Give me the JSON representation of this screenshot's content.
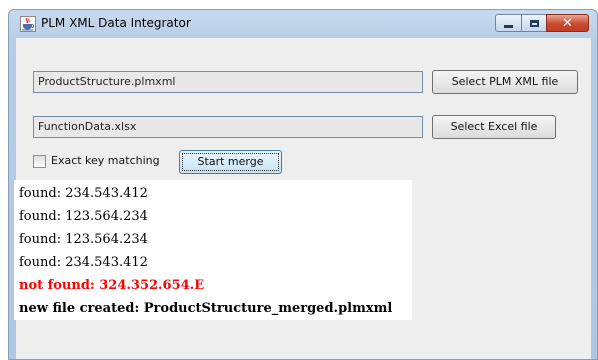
{
  "window": {
    "title": "PLM XML Data Integrator",
    "close_glyph": "✕",
    "close_color": "#c94b32"
  },
  "inputs": {
    "plmxml_file": "ProductStructure.plmxml",
    "excel_file": "FunctionData.xlsx"
  },
  "buttons": {
    "select_plmxml": "Select PLM XML file",
    "select_excel": "Select Excel file",
    "start_merge": "Start merge"
  },
  "options": {
    "exact_key_matching_label": "Exact key matching",
    "exact_key_matching_checked": false
  },
  "log": {
    "lines": [
      {
        "text": "found: 234.543.412",
        "color": "#000000",
        "bold": false
      },
      {
        "text": "found: 123.564.234",
        "color": "#000000",
        "bold": false
      },
      {
        "text": "found: 123.564.234",
        "color": "#000000",
        "bold": false
      },
      {
        "text": "found: 234.543.412",
        "color": "#000000",
        "bold": false
      },
      {
        "text": "not found: 324.352.654.E",
        "color": "#ff0000",
        "bold": true
      },
      {
        "text": "new file created: ProductStructure_merged.plmxml",
        "color": "#000000",
        "bold": true
      }
    ]
  },
  "icons": {
    "app_icon": "java-coffee-cup-icon",
    "minimize": "minimize-icon",
    "maximize": "maximize-icon",
    "close": "close-icon"
  }
}
